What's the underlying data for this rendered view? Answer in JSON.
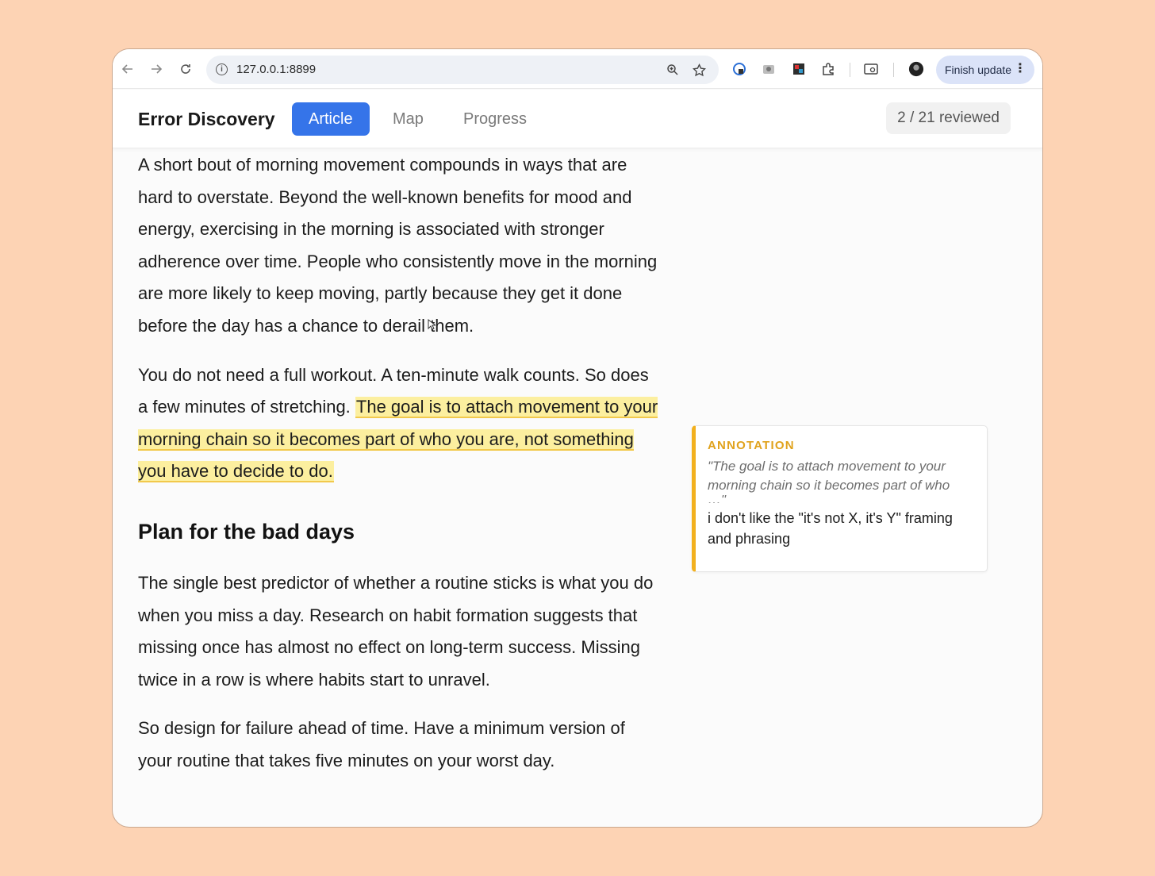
{
  "browser": {
    "url": "127.0.0.1:8899",
    "finish_update_label": "Finish update"
  },
  "app": {
    "title": "Error Discovery",
    "tabs": [
      {
        "label": "Article",
        "active": true
      },
      {
        "label": "Map",
        "active": false
      },
      {
        "label": "Progress",
        "active": false
      }
    ],
    "review_counter": "2 / 21 reviewed"
  },
  "article": {
    "paragraph_1": "A short bout of morning movement compounds in ways that are hard to overstate. Beyond the well-known benefits for mood and energy, exercising in the morning is associated with stronger adherence over time. People who consistently move in the morning are more likely to keep moving, partly because they get it done before the day has a chance to derail them.",
    "paragraph_2_plain": "You do not need a full workout. A ten-minute walk counts. So does a few minutes of stretching. ",
    "paragraph_2_highlight": "The goal is to attach movement to your morning chain so it becomes part of who you are, not something you have to decide to do.",
    "heading": "Plan for the bad days",
    "paragraph_3": "The single best predictor of whether a routine sticks is what you do when you miss a day. Research on habit formation suggests that missing once has almost no effect on long-term success. Missing twice in a row is where habits start to unravel.",
    "paragraph_4": "So design for failure ahead of time. Have a minimum version of your routine that takes five minutes on your worst day."
  },
  "annotation": {
    "label": "ANNOTATION",
    "quote": "\"The goal is to attach movement to your morning chain so it becomes part of who",
    "quote_cut": "…\"",
    "note": "i don't like the \"it's not X, it's Y\" framing and phrasing"
  },
  "colors": {
    "tab_active": "#3574e9",
    "highlight": "#fcef9f",
    "annotation_accent": "#f2b01e",
    "background": "#fdd3b4"
  },
  "icons": [
    "back-arrow-icon",
    "forward-arrow-icon",
    "reload-icon",
    "info-icon",
    "zoom-icon",
    "star-icon",
    "extension-icon",
    "puzzle-icon",
    "sidebar-icon",
    "avatar",
    "more-vert-icon"
  ]
}
